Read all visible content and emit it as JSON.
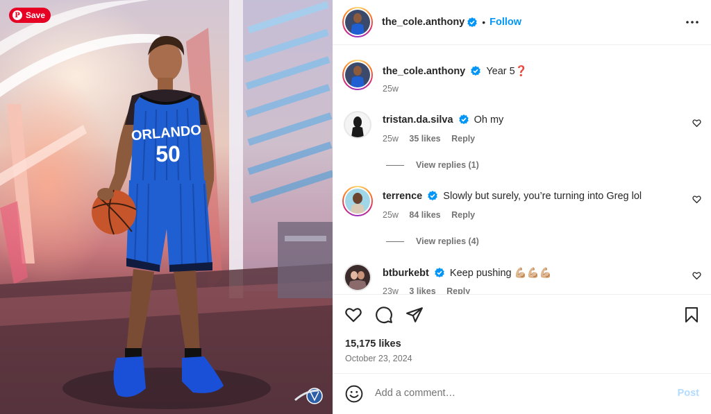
{
  "image": {
    "save_label": "Save",
    "pin_glyph": "P",
    "jersey_team": "ORLANDO",
    "jersey_number": "50"
  },
  "header": {
    "username": "the_cole.anthony",
    "separator": "•",
    "follow_label": "Follow",
    "more_icon": "more-horizontal-icon"
  },
  "caption": {
    "username": "the_cole.anthony",
    "text": "Year 5❓",
    "time": "25w"
  },
  "comments": [
    {
      "username": "tristan.da.silva",
      "text": "Oh my",
      "time": "25w",
      "likes": "35 likes",
      "reply": "Reply",
      "view_replies": "View replies (1)"
    },
    {
      "username": "terrence",
      "text": "Slowly but surely, you’re turning into Greg lol",
      "time": "25w",
      "likes": "84 likes",
      "reply": "Reply",
      "view_replies": "View replies (4)"
    },
    {
      "username": "btburkebt",
      "text": "Keep pushing 💪🏼💪🏼💪🏼",
      "time": "23w",
      "likes": "3 likes",
      "reply": "Reply"
    }
  ],
  "footer": {
    "likes": "15,175 likes",
    "date": "October 23, 2024",
    "comment_placeholder": "Add a comment…",
    "post_label": "Post"
  },
  "colors": {
    "accent": "#0095f6",
    "pinterest": "#e60023",
    "jersey": "#1f5fd1",
    "post_disabled": "#b3dbff"
  }
}
